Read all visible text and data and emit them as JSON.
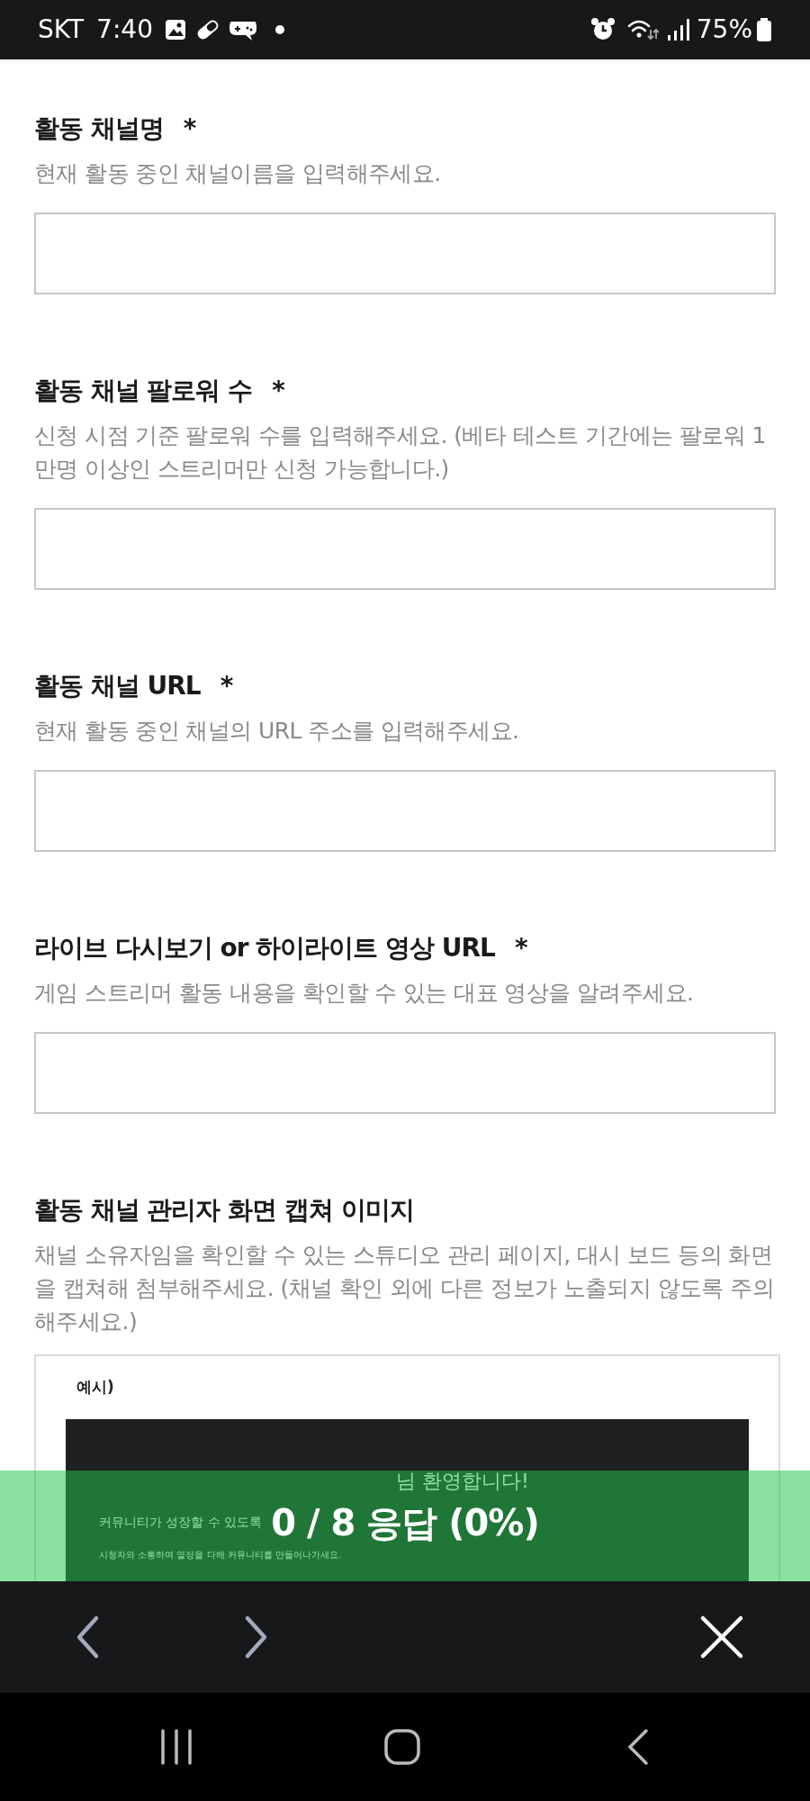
{
  "status_bar": {
    "carrier": "SKT",
    "time": "7:40",
    "battery": "75%"
  },
  "fields": [
    {
      "kind": "input",
      "title": "활동 채널명",
      "required_mark": "*",
      "description": "현재 활동 중인 채널이름을 입력해주세요."
    },
    {
      "kind": "input",
      "title": "활동 채널 팔로워 수",
      "required_mark": "*",
      "description": "신청 시점 기준 팔로워 수를 입력해주세요. (베타 테스트 기간에는 팔로워 1만명 이상인 스트리머만 신청 가능합니다.)"
    },
    {
      "kind": "input",
      "title": "활동 채널 URL",
      "required_mark": "*",
      "description": "현재 활동 중인 채널의 URL 주소를 입력해주세요."
    },
    {
      "kind": "input",
      "title": "라이브 다시보기 or 하이라이트 영상 URL",
      "required_mark": "*",
      "description": "게임 스트리머 활동 내용을 확인할 수 있는 대표 영상을 알려주세요."
    },
    {
      "kind": "image",
      "title": "활동 채널 관리자 화면 캡쳐 이미지",
      "description": "채널 소유자임을 확인할 수 있는 스튜디오 관리 페이지, 대시 보드 등의 화면을 캡쳐해 첨부해주세요. (채널 확인 외에 다른 정보가 노출되지 않도록 주의해주세요.)",
      "example": {
        "label": "예시)",
        "welcome": "님 환영합니다!",
        "headline": "커뮤니티가 성장할 수 있도록",
        "subline": "시청자와 소통하며 열정을 다해 커뮤니티를 만들어나가세요."
      }
    }
  ],
  "progress": {
    "text": "0 / 8 응답 (0%)"
  }
}
